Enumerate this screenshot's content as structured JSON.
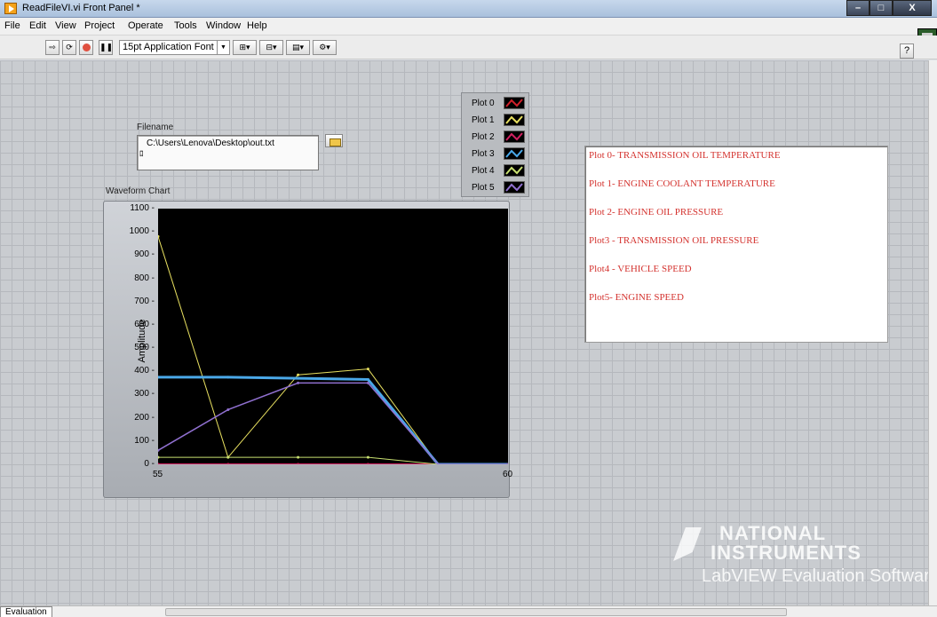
{
  "window": {
    "title": "ReadFileVI.vi Front Panel *",
    "controls": {
      "minimize": "–",
      "maximize": "□",
      "close": "X"
    }
  },
  "menu": [
    "File",
    "Edit",
    "View",
    "Project",
    "Operate",
    "Tools",
    "Window",
    "Help"
  ],
  "toolbar": {
    "run_icon": "run-arrow-icon",
    "run_continuous_icon": "run-continuously-icon",
    "abort_icon": "abort-icon",
    "pause_icon": "pause-icon",
    "font_select": "15pt Application Font",
    "align_icon": "align-objects-icon",
    "distribute_icon": "distribute-objects-icon",
    "resize_icon": "resize-objects-icon",
    "reorder_icon": "reorder-icon",
    "help": "?"
  },
  "filename": {
    "label": "Filename",
    "value": "C:\\Users\\Lenova\\Desktop\\out.txt",
    "prefix": "ﾛ"
  },
  "legend": [
    {
      "name": "Plot 0",
      "color": "#d0202a"
    },
    {
      "name": "Plot 1",
      "color": "#e8e060"
    },
    {
      "name": "Plot 2",
      "color": "#d02060"
    },
    {
      "name": "Plot 3",
      "color": "#4aa8e8"
    },
    {
      "name": "Plot 4",
      "color": "#c8e070"
    },
    {
      "name": "Plot 5",
      "color": "#9070d0"
    }
  ],
  "chart_title": "Waveform Chart",
  "chart_data": {
    "type": "line",
    "ylabel": "Amplitude",
    "xlabel": "",
    "xlim": [
      55,
      60
    ],
    "ylim": [
      0,
      1100
    ],
    "yticks": [
      0,
      100,
      200,
      300,
      400,
      500,
      600,
      700,
      800,
      900,
      1000,
      1100
    ],
    "xticks": [
      55,
      60
    ],
    "x": [
      55,
      56,
      57,
      58,
      59,
      60
    ],
    "series": [
      {
        "name": "Plot 0",
        "values": [
          0,
          0,
          0,
          0,
          0,
          0
        ]
      },
      {
        "name": "Plot 1",
        "values": [
          980,
          30,
          385,
          410,
          0,
          0
        ]
      },
      {
        "name": "Plot 2",
        "values": [
          0,
          0,
          0,
          0,
          0,
          0
        ]
      },
      {
        "name": "Plot 3",
        "values": [
          375,
          375,
          370,
          365,
          0,
          0
        ]
      },
      {
        "name": "Plot 4",
        "values": [
          30,
          30,
          30,
          30,
          0,
          0
        ]
      },
      {
        "name": "Plot 5",
        "values": [
          60,
          235,
          350,
          350,
          0,
          0
        ]
      }
    ]
  },
  "notes": [
    "Plot 0- TRANSMISSION OIL TEMPERATURE",
    "Plot 1- ENGINE COOLANT TEMPERATURE",
    "Plot 2- ENGINE OIL PRESSURE",
    "Plot3 - TRANSMISSION OIL PRESSURE",
    "Plot4 - VEHICLE SPEED",
    "Plot5- ENGINE SPEED"
  ],
  "watermark": {
    "line1": "NATIONAL",
    "line2": "INSTRUMENTS",
    "line3": "LabVIEW Evaluation Software"
  },
  "status": {
    "tab": "Evaluation"
  }
}
